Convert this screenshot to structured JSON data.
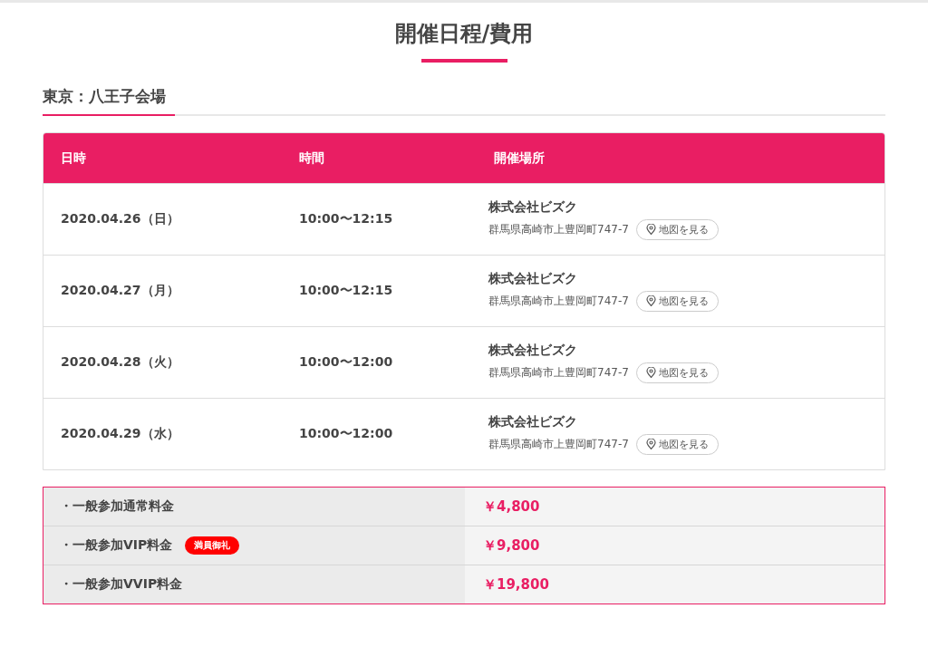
{
  "title": "開催日程/費用",
  "section": {
    "heading": "東京：八王子会場"
  },
  "schedule": {
    "columns": [
      "日時",
      "時間",
      "開催場所"
    ],
    "rows": [
      {
        "date": "2020.04.26（日）",
        "time": "10:00〜12:15",
        "venue": "株式会社ビズク",
        "address": "群馬県高崎市上豊岡町747-7",
        "map_button": "地図を見る"
      },
      {
        "date": "2020.04.27（月）",
        "time": "10:00〜12:15",
        "venue": "株式会社ビズク",
        "address": "群馬県高崎市上豊岡町747-7",
        "map_button": "地図を見る"
      },
      {
        "date": "2020.04.28（火）",
        "time": "10:00〜12:00",
        "venue": "株式会社ビズク",
        "address": "群馬県高崎市上豊岡町747-7",
        "map_button": "地図を見る"
      },
      {
        "date": "2020.04.29（水）",
        "time": "10:00〜12:00",
        "venue": "株式会社ビズク",
        "address": "群馬県高崎市上豊岡町747-7",
        "map_button": "地図を見る"
      }
    ]
  },
  "prices": [
    {
      "label": "・一般参加通常料金",
      "price": "￥4,800"
    },
    {
      "label": "・一般参加VIP料金",
      "badge": "満員御礼",
      "price": "￥9,800"
    },
    {
      "label": "・一般参加VVIP料金",
      "price": "￥19,800"
    }
  ]
}
